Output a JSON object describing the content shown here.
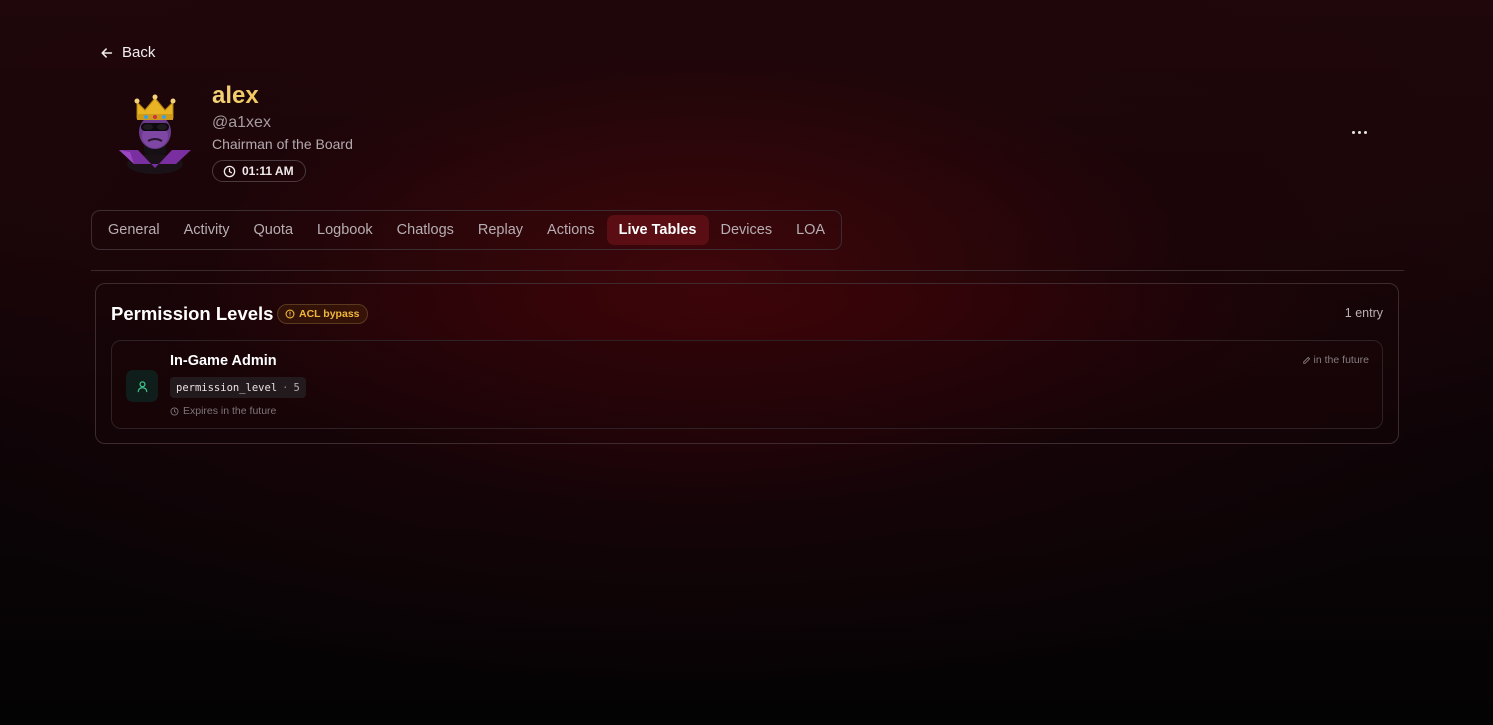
{
  "nav": {
    "back_label": "Back"
  },
  "profile": {
    "display_name": "alex",
    "username": "@a1xex",
    "role": "Chairman of the Board",
    "local_time": "01:11 AM"
  },
  "tabs": [
    {
      "label": "General",
      "active": false
    },
    {
      "label": "Activity",
      "active": false
    },
    {
      "label": "Quota",
      "active": false
    },
    {
      "label": "Logbook",
      "active": false
    },
    {
      "label": "Chatlogs",
      "active": false
    },
    {
      "label": "Replay",
      "active": false
    },
    {
      "label": "Actions",
      "active": false
    },
    {
      "label": "Live Tables",
      "active": true
    },
    {
      "label": "Devices",
      "active": false
    },
    {
      "label": "LOA",
      "active": false
    }
  ],
  "panel": {
    "title": "Permission Levels",
    "badge": "ACL bypass",
    "count": "1 entry",
    "entries": [
      {
        "title": "In-Game Admin",
        "key": "permission_level",
        "separator": "·",
        "value": "5",
        "expires": "Expires in the future",
        "edited": "in the future"
      }
    ]
  },
  "colors": {
    "accent": "#5a0d12",
    "name_gold": "#f0c24b",
    "badge_amber": "#f0b83a",
    "entry_icon_green": "#3fbf8a"
  },
  "icons": {
    "back": "arrow-left-icon",
    "time": "clock-icon",
    "more": "more-horizontal-icon",
    "badge": "alert-circle-icon",
    "entry": "user-icon",
    "expires": "clock-icon",
    "edited": "pencil-icon"
  }
}
